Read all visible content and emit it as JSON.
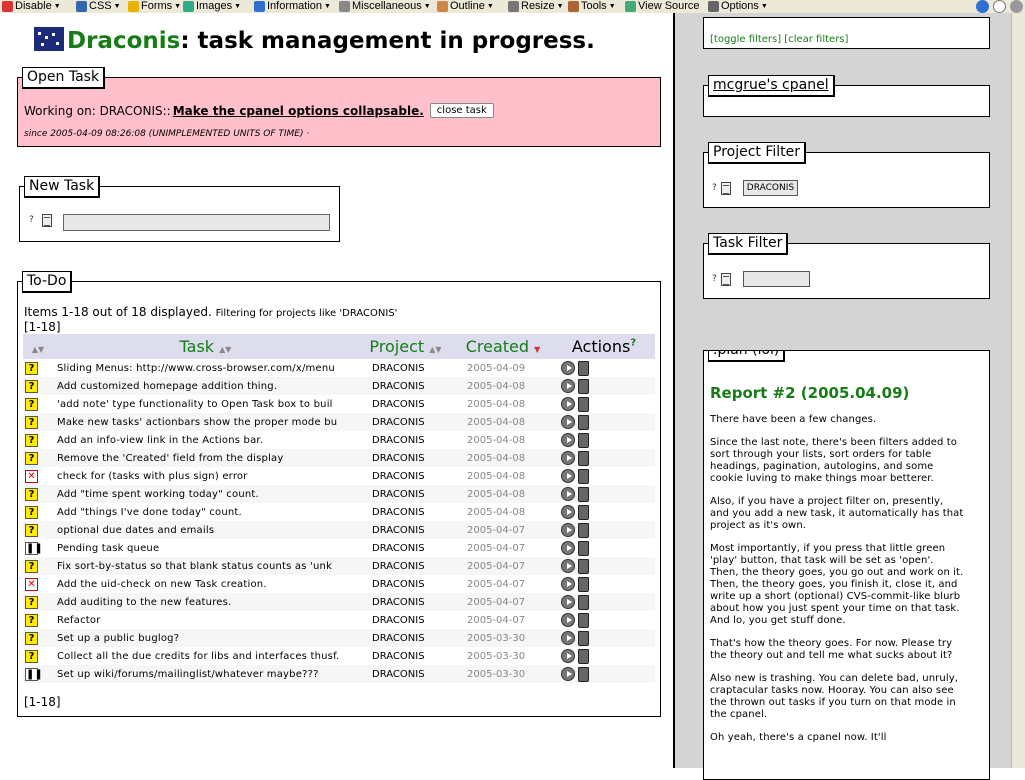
{
  "toolbar": {
    "items": [
      "Disable",
      "CSS",
      "Forms",
      "Images",
      "Information",
      "Miscellaneous",
      "Outline",
      "Resize",
      "Tools",
      "View Source",
      "Options"
    ]
  },
  "header": {
    "title_brand": "Draconis",
    "title_rest": ": task management in progress."
  },
  "open_task": {
    "legend": "Open Task",
    "working_on": "Working on: DRACONIS::",
    "task_link": "Make the cpanel options collapsable.",
    "close_button": "close task",
    "since": "since 2005-04-09 08:26:08 (UNIMPLEMENTED UNITS OF TIME)",
    "since_link": "·"
  },
  "new_task": {
    "legend": "New Task",
    "help": "?",
    "input_value": ""
  },
  "todo": {
    "legend": "To-Do",
    "count": "Items 1-18 out of 18 displayed.",
    "filter_note": "Filtering for projects like 'DRACONIS'",
    "pager_top": "[1-18]",
    "pager_bottom": "[1-18]",
    "columns": {
      "task": "Task",
      "project": "Project",
      "created": "Created",
      "actions": "Actions",
      "actions_help": "?"
    },
    "rows": [
      {
        "status": "open",
        "task": "Sliding Menus: http://www.cross-browser.com/x/menu",
        "project": "DRACONIS",
        "created": "2005-04-09"
      },
      {
        "status": "open",
        "task": "Add customized homepage addition thing.",
        "project": "DRACONIS",
        "created": "2005-04-08"
      },
      {
        "status": "open",
        "task": "'add note' type functionality to Open Task box to buil",
        "project": "DRACONIS",
        "created": "2005-04-08"
      },
      {
        "status": "open",
        "task": "Make new tasks' actionbars show the proper mode bu",
        "project": "DRACONIS",
        "created": "2005-04-08"
      },
      {
        "status": "open",
        "task": "Add an info-view link in the Actions bar.",
        "project": "DRACONIS",
        "created": "2005-04-08"
      },
      {
        "status": "open",
        "task": "Remove the 'Created' field from the display",
        "project": "DRACONIS",
        "created": "2005-04-08"
      },
      {
        "status": "trash",
        "task": "check for (tasks with plus sign) error",
        "project": "DRACONIS",
        "created": "2005-04-08"
      },
      {
        "status": "open",
        "task": "Add \"time spent working today\" count.",
        "project": "DRACONIS",
        "created": "2005-04-08"
      },
      {
        "status": "open",
        "task": "Add \"things I've done today\" count.",
        "project": "DRACONIS",
        "created": "2005-04-08"
      },
      {
        "status": "open",
        "task": "optional due dates and emails",
        "project": "DRACONIS",
        "created": "2005-04-07"
      },
      {
        "status": "pause",
        "task": "Pending task queue",
        "project": "DRACONIS",
        "created": "2005-04-07"
      },
      {
        "status": "open",
        "task": "Fix sort-by-status so that blank status counts as 'unk",
        "project": "DRACONIS",
        "created": "2005-04-07"
      },
      {
        "status": "trash",
        "task": "Add the uid-check on new Task creation.",
        "project": "DRACONIS",
        "created": "2005-04-07"
      },
      {
        "status": "open",
        "task": "Add auditing to the new features.",
        "project": "DRACONIS",
        "created": "2005-04-07"
      },
      {
        "status": "open",
        "task": "Refactor",
        "project": "DRACONIS",
        "created": "2005-04-07"
      },
      {
        "status": "open",
        "task": "Set up a public buglog?",
        "project": "DRACONIS",
        "created": "2005-03-30"
      },
      {
        "status": "open",
        "task": "Collect all the due credits for libs and interfaces thusf.",
        "project": "DRACONIS",
        "created": "2005-03-30"
      },
      {
        "status": "pause",
        "task": "Set up wiki/forums/mailinglist/whatever maybe???",
        "project": "DRACONIS",
        "created": "2005-03-30"
      }
    ]
  },
  "sidebar": {
    "filter_links": "[toggle filters] [clear filters]",
    "cpanel_legend": "mcgrue's cpanel",
    "project_filter": {
      "legend": "Project Filter",
      "help": "?",
      "value": "DRACONIS"
    },
    "task_filter": {
      "legend": "Task Filter",
      "help": "?",
      "value": ""
    },
    "plan": {
      "legend": ".plan (lol)",
      "report_title": "Report #2 (2005.04.09)",
      "paragraphs": [
        "There have been a few changes.",
        "Since the last note, there's been filters added to sort through your lists, sort orders for table headings, pagination, autologins, and some cookie luving to make things moar betterer.",
        "Also, if you have a project filter on, presently, and you add a new task, it automatically has that project as it's own.",
        "Most importantly, if you press that little green 'play' button, that task will be set as 'open'. Then, the theory goes, you go out and work on it. Then, the theory goes, you finish it, close it, and write up a short (optional) CVS-commit-like blurb about how you just spent your time on that task. And lo, you get stuff done.",
        "That's how the theory goes. For now. Please try the theory out and tell me what sucks about it?",
        "Also new is trashing. You can delete bad, unruly, craptacular tasks now. Hooray. You can also see the thrown out tasks if you turn on that mode in the cpanel.",
        "Oh yeah, there's a cpanel now. It'll"
      ]
    }
  }
}
